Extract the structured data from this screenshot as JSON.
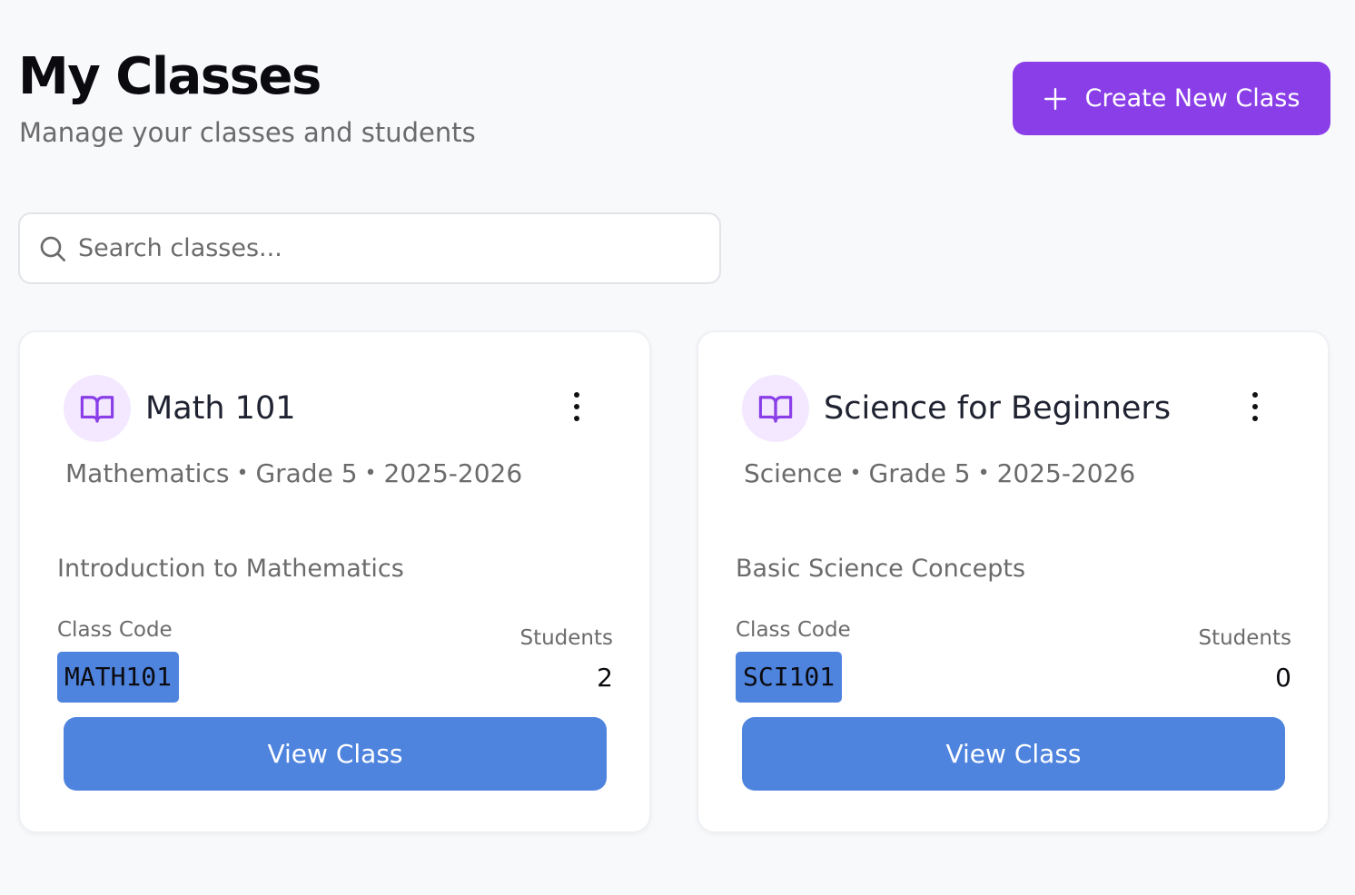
{
  "header": {
    "title": "My Classes",
    "subtitle": "Manage your classes and students",
    "create_button_label": "Create New Class",
    "create_button_icon": "plus-icon"
  },
  "search": {
    "placeholder": "Search classes...",
    "value": "",
    "icon": "search-icon"
  },
  "colors": {
    "accent_purple": "#8a3ee8",
    "primary_blue": "#4f84de",
    "icon_bg": "#f3e8ff",
    "background": "#f8f9fb"
  },
  "classes": [
    {
      "icon": "book-icon",
      "name": "Math 101",
      "subject": "Mathematics",
      "grade": "Grade 5",
      "year": "2025-2026",
      "description": "Introduction to Mathematics",
      "code_label": "Class Code",
      "code": "MATH101",
      "students_label": "Students",
      "students": "2",
      "view_label": "View Class"
    },
    {
      "icon": "book-icon",
      "name": "Science for Beginners",
      "subject": "Science",
      "grade": "Grade 5",
      "year": "2025-2026",
      "description": "Basic Science Concepts",
      "code_label": "Class Code",
      "code": "SCI101",
      "students_label": "Students",
      "students": "0",
      "view_label": "View Class"
    }
  ]
}
